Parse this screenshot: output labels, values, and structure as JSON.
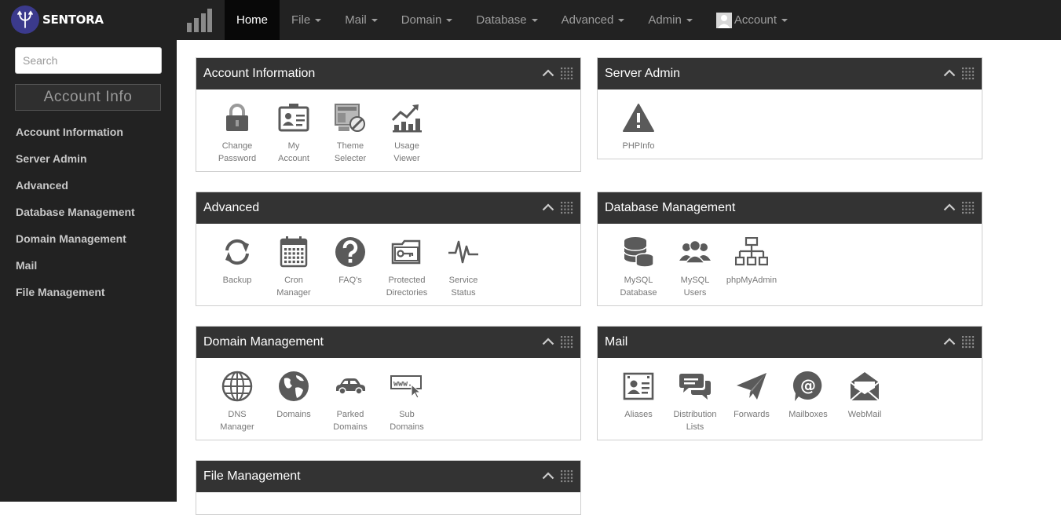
{
  "brand": {
    "name": "SENTORA"
  },
  "nav": [
    {
      "label": "Home",
      "dropdown": false,
      "active": true
    },
    {
      "label": "File",
      "dropdown": true
    },
    {
      "label": "Mail",
      "dropdown": true
    },
    {
      "label": "Domain",
      "dropdown": true
    },
    {
      "label": "Database",
      "dropdown": true
    },
    {
      "label": "Advanced",
      "dropdown": true
    },
    {
      "label": "Admin",
      "dropdown": true
    },
    {
      "label": "Account",
      "dropdown": true
    }
  ],
  "sidebar": {
    "search_placeholder": "Search",
    "heading": "Account Info",
    "links": [
      "Account Information",
      "Server Admin",
      "Advanced",
      "Database Management",
      "Domain Management",
      "Mail",
      "File Management"
    ]
  },
  "panels": {
    "account": {
      "title": "Account Information",
      "modules": [
        {
          "label": "Change\nPassword",
          "icon": "lock-icon"
        },
        {
          "label": "My\nAccount",
          "icon": "id-card-icon"
        },
        {
          "label": "Theme\nSelecter",
          "icon": "theme-icon"
        },
        {
          "label": "Usage\nViewer",
          "icon": "usage-chart-icon"
        }
      ]
    },
    "server": {
      "title": "Server Admin",
      "modules": [
        {
          "label": "PHPInfo",
          "icon": "warning-icon"
        }
      ]
    },
    "advanced": {
      "title": "Advanced",
      "modules": [
        {
          "label": "Backup",
          "icon": "refresh-icon"
        },
        {
          "label": "Cron\nManager",
          "icon": "calendar-icon"
        },
        {
          "label": "FAQ's",
          "icon": "question-icon"
        },
        {
          "label": "Protected\nDirectories",
          "icon": "protected-folder-icon"
        },
        {
          "label": "Service\nStatus",
          "icon": "pulse-icon"
        }
      ]
    },
    "database": {
      "title": "Database Management",
      "modules": [
        {
          "label": "MySQL\nDatabase",
          "icon": "database-icon"
        },
        {
          "label": "MySQL\nUsers",
          "icon": "users-icon"
        },
        {
          "label": "phpMyAdmin",
          "icon": "sitemap-icon"
        }
      ]
    },
    "domain": {
      "title": "Domain Management",
      "modules": [
        {
          "label": "DNS\nManager",
          "icon": "globe-grid-icon"
        },
        {
          "label": "Domains",
          "icon": "globe-icon"
        },
        {
          "label": "Parked\nDomains",
          "icon": "car-icon"
        },
        {
          "label": "Sub\nDomains",
          "icon": "www-cursor-icon"
        }
      ]
    },
    "mail": {
      "title": "Mail",
      "modules": [
        {
          "label": "Aliases",
          "icon": "contact-card-icon"
        },
        {
          "label": "Distribution\nLists",
          "icon": "chat-bubbles-icon"
        },
        {
          "label": "Forwards",
          "icon": "paper-plane-icon"
        },
        {
          "label": "Mailboxes",
          "icon": "at-sign-icon"
        },
        {
          "label": "WebMail",
          "icon": "open-envelope-icon"
        }
      ]
    },
    "files": {
      "title": "File Management",
      "modules": []
    }
  }
}
